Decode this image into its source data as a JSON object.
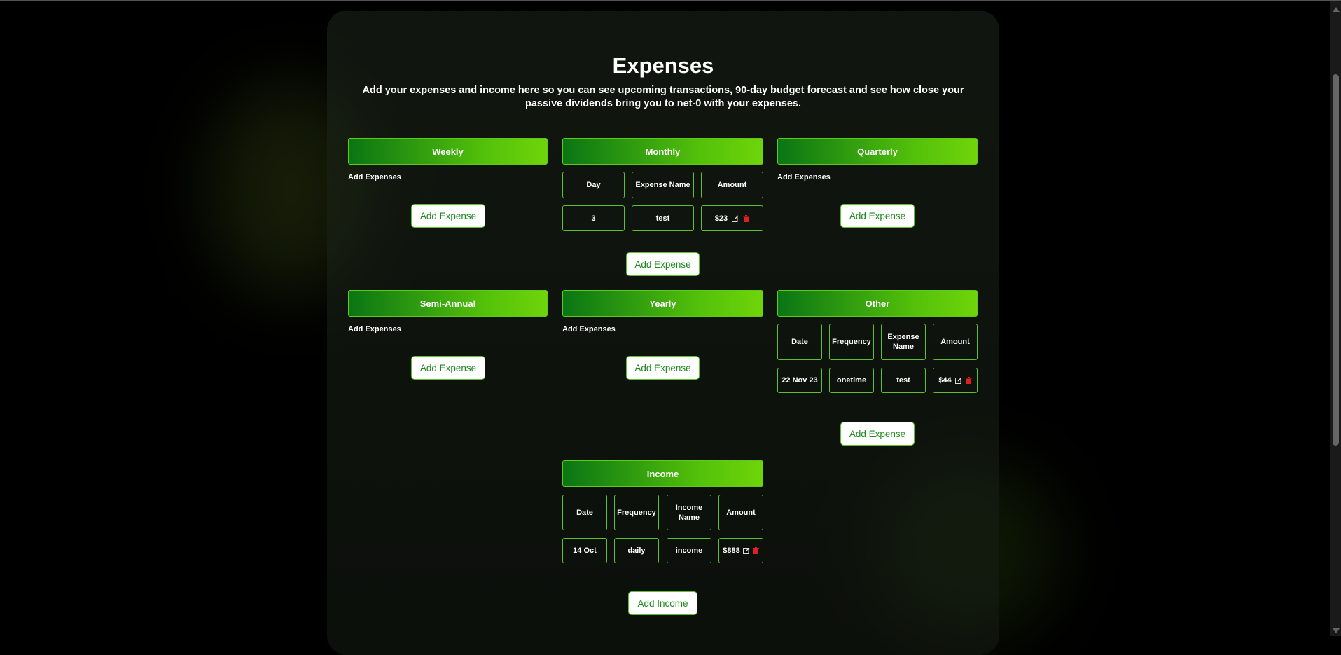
{
  "page": {
    "title": "Expenses",
    "subtitle": "Add your expenses and income here so you can see upcoming transactions, 90-day budget forecast and see how close your passive dividends bring you to net-0 with your expenses."
  },
  "colors": {
    "accent_green": "#55c20a",
    "header_dark_green": "#0a7514",
    "button_text": "#1e8a1e",
    "delete_red": "#e02020"
  },
  "sections": {
    "weekly": {
      "title": "Weekly",
      "note": "Add Expenses",
      "button": "Add Expense"
    },
    "monthly": {
      "title": "Monthly",
      "columns": [
        "Day",
        "Expense Name",
        "Amount"
      ],
      "rows": [
        {
          "day": "3",
          "name": "test",
          "amount": "$23"
        }
      ],
      "button": "Add Expense"
    },
    "quarterly": {
      "title": "Quarterly",
      "note": "Add Expenses",
      "button": "Add Expense"
    },
    "semi_annual": {
      "title": "Semi-Annual",
      "note": "Add Expenses",
      "button": "Add Expense"
    },
    "yearly": {
      "title": "Yearly",
      "note": "Add Expenses",
      "button": "Add Expense"
    },
    "other": {
      "title": "Other",
      "columns": [
        "Date",
        "Frequency",
        "Expense Name",
        "Amount"
      ],
      "rows": [
        {
          "date": "22 Nov 23",
          "frequency": "onetime",
          "name": "test",
          "amount": "$44"
        }
      ],
      "button": "Add Expense"
    },
    "income": {
      "title": "Income",
      "columns": [
        "Date",
        "Frequency",
        "Income Name",
        "Amount"
      ],
      "rows": [
        {
          "date": "14 Oct",
          "frequency": "daily",
          "name": "income",
          "amount": "$888"
        }
      ],
      "button": "Add Income"
    }
  },
  "icons": {
    "edit": "edit-icon",
    "delete": "trash-icon"
  }
}
